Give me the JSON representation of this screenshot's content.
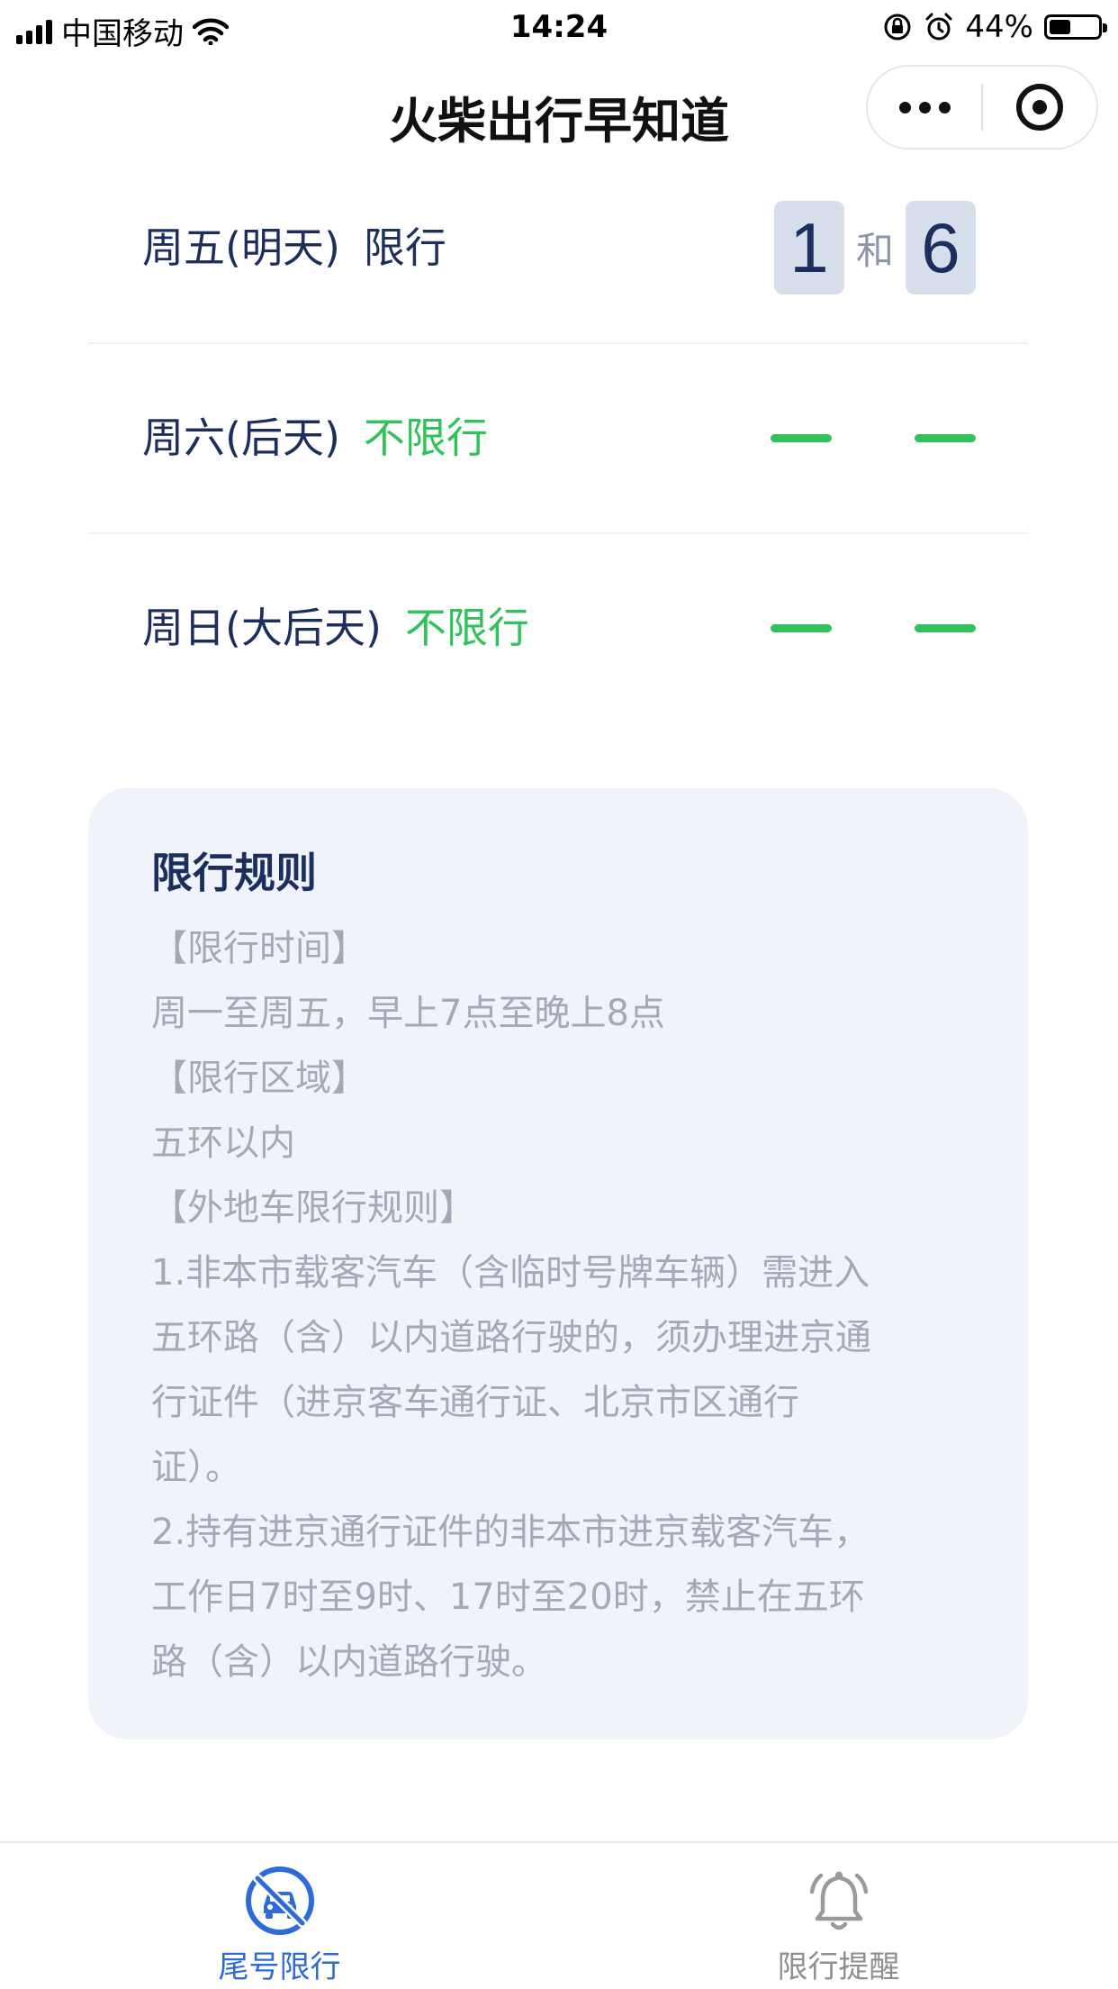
{
  "status_bar": {
    "carrier": "中国移动",
    "time": "14:24",
    "battery_text": "44%",
    "battery_level": 0.44
  },
  "nav": {
    "title": "火柴出行早知道"
  },
  "days": [
    {
      "label": "周五(明天)",
      "status": "限行",
      "restricted": true,
      "plate_numbers": [
        "1",
        "6"
      ],
      "and_text": "和"
    },
    {
      "label": "周六(后天)",
      "status": "不限行",
      "restricted": false
    },
    {
      "label": "周日(大后天)",
      "status": "不限行",
      "restricted": false
    }
  ],
  "rules": {
    "title": "限行规则",
    "lines": [
      "【限行时间】",
      "周一至周五，早上7点至晚上8点",
      "【限行区域】",
      "五环以内",
      "【外地车限行规则】",
      "1.非本市载客汽车（含临时号牌车辆）需进入",
      "五环路（含）以内道路行驶的，须办理进京通",
      "行证件（进京客车通行证、北京市区通行",
      "证）。",
      "2.持有进京通行证件的非本市进京载客汽车，",
      "工作日7时至9时、17时至20时，禁止在五环",
      "路（含）以内道路行驶。"
    ]
  },
  "tabs": [
    {
      "label": "尾号限行",
      "icon": "no-car-icon",
      "active": true
    },
    {
      "label": "限行提醒",
      "icon": "bell-icon",
      "active": false
    }
  ],
  "colors": {
    "accent_blue": "#2f6bd8",
    "free_green": "#30c35a",
    "text_navy": "#1c2f5c",
    "muted_gray": "#a3a9b6",
    "card_bg": "#f0f3f9"
  }
}
